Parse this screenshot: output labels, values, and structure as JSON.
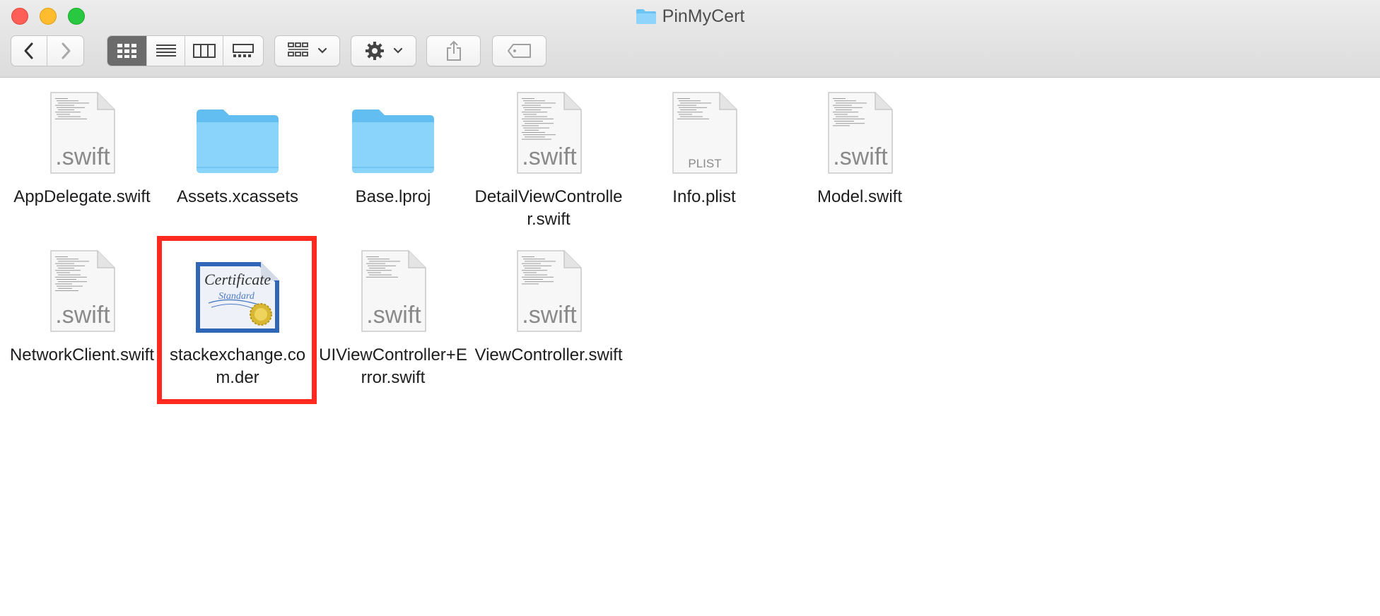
{
  "window": {
    "title": "PinMyCert"
  },
  "toolbar": {
    "back_icon": "chevron-left-icon",
    "forward_icon": "chevron-right-icon",
    "view_modes": [
      "icon-view-icon",
      "list-view-icon",
      "column-view-icon",
      "gallery-view-icon"
    ],
    "active_view": "icon-view-icon",
    "group_icon": "group-by-icon",
    "action_icon": "gear-icon",
    "share_icon": "share-icon",
    "tag_icon": "tag-icon"
  },
  "files": [
    {
      "name": "AppDelegate.swift",
      "kind": "swift",
      "ext_label": ".swift"
    },
    {
      "name": "Assets.xcassets",
      "kind": "folder"
    },
    {
      "name": "Base.lproj",
      "kind": "folder"
    },
    {
      "name": "DetailViewController.swift",
      "kind": "swift",
      "ext_label": ".swift"
    },
    {
      "name": "Info.plist",
      "kind": "plist",
      "ext_label": "PLIST"
    },
    {
      "name": "Model.swift",
      "kind": "swift",
      "ext_label": ".swift"
    },
    {
      "name": "NetworkClient.swift",
      "kind": "swift",
      "ext_label": ".swift"
    },
    {
      "name": "stackexchange.com.der",
      "kind": "certificate",
      "cert_title": "Certificate",
      "cert_sub": "Standard",
      "selected": true
    },
    {
      "name": "UIViewController+Error.swift",
      "kind": "swift",
      "ext_label": ".swift"
    },
    {
      "name": "ViewController.swift",
      "kind": "swift",
      "ext_label": ".swift"
    }
  ],
  "colors": {
    "selection_highlight": "#ff2a1f",
    "folder_blue": "#6cc4f4"
  }
}
